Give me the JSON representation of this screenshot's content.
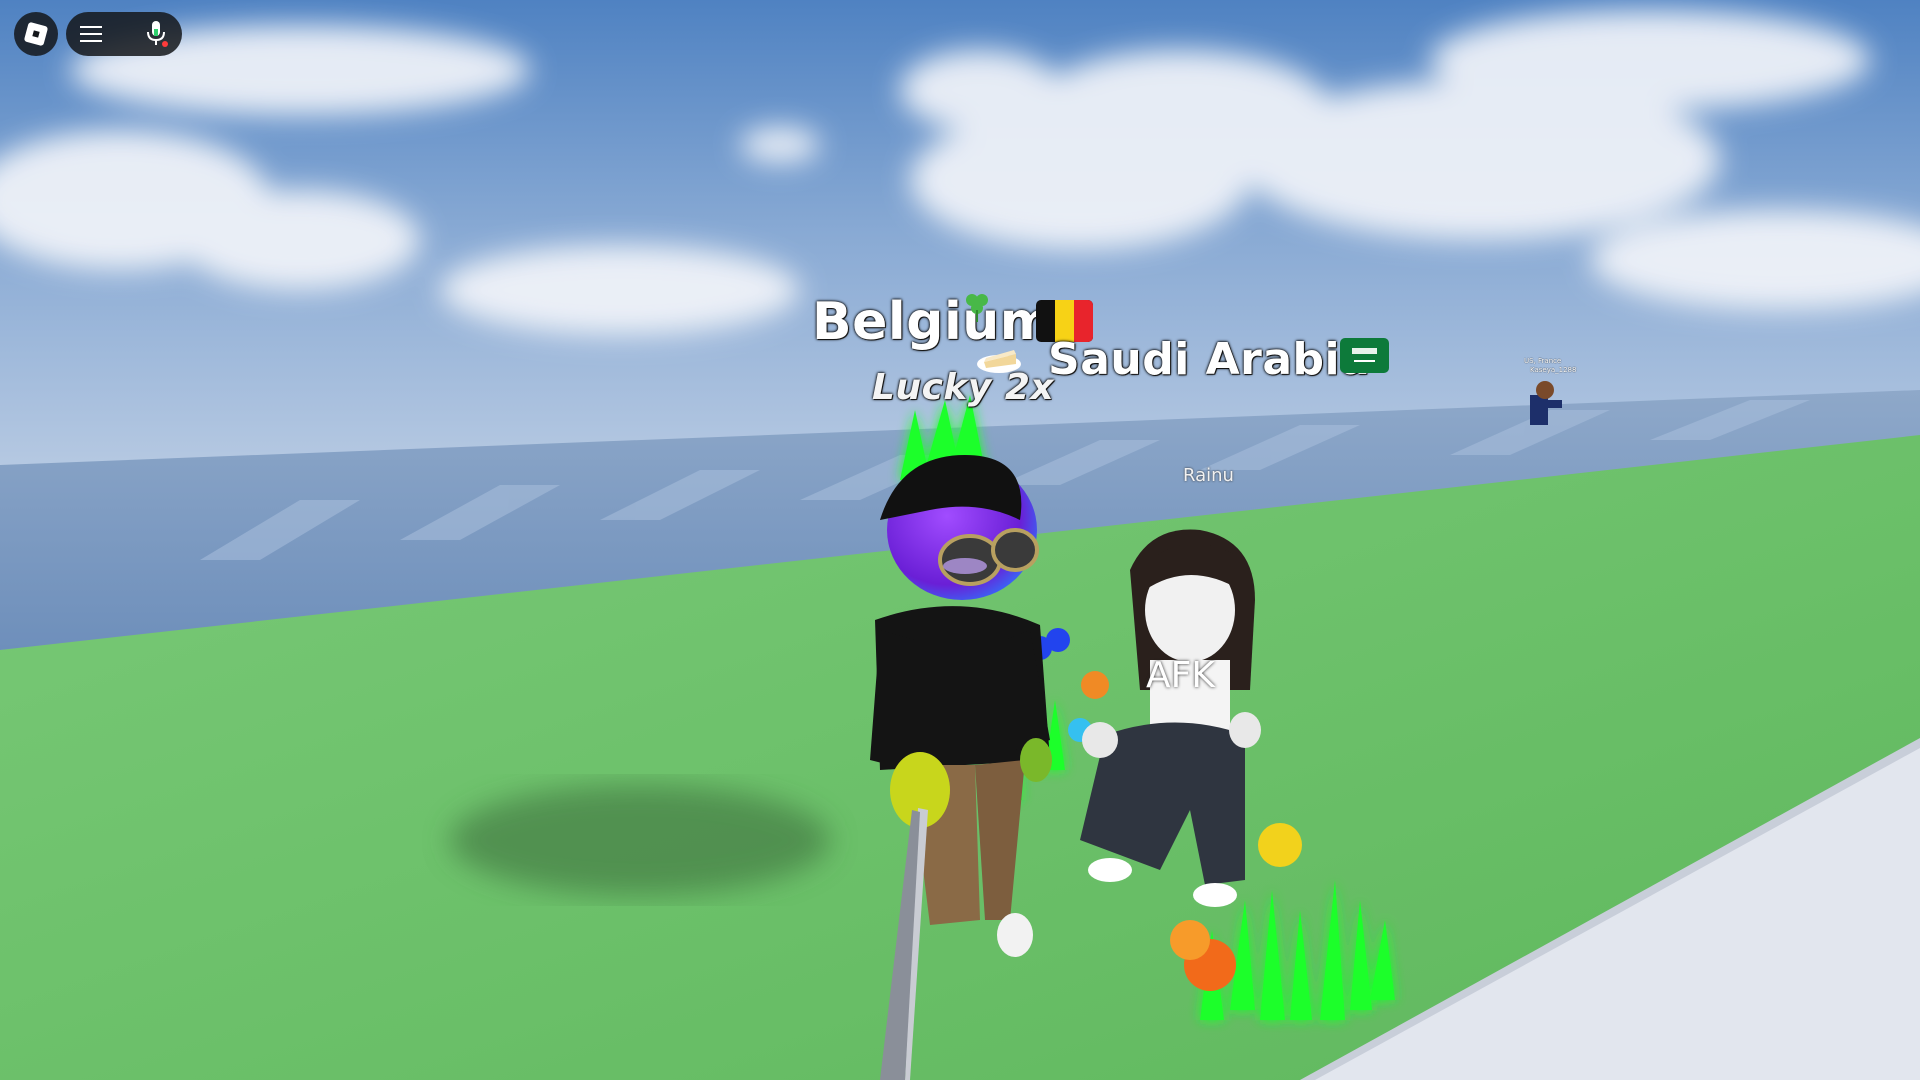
{
  "hud": {
    "logo_icon": "roblox-logo-icon",
    "menu_icon": "hamburger-menu-icon",
    "mic_icon": "microphone-icon"
  },
  "nametags": {
    "player1_country": "Belgium",
    "player1_buff": "Lucky 2x",
    "player2_country": "Saudi Arabia",
    "player2_name": "Rainu",
    "player2_status": "AFK",
    "far_player_country": "US, France",
    "far_player_name": "Kaseya_1288"
  },
  "colors": {
    "sky": "#6f98c9",
    "grass": "#6fc36d",
    "water": "#7f9fc7",
    "path": "#e2e6ee",
    "glow": "#1cff2a"
  }
}
